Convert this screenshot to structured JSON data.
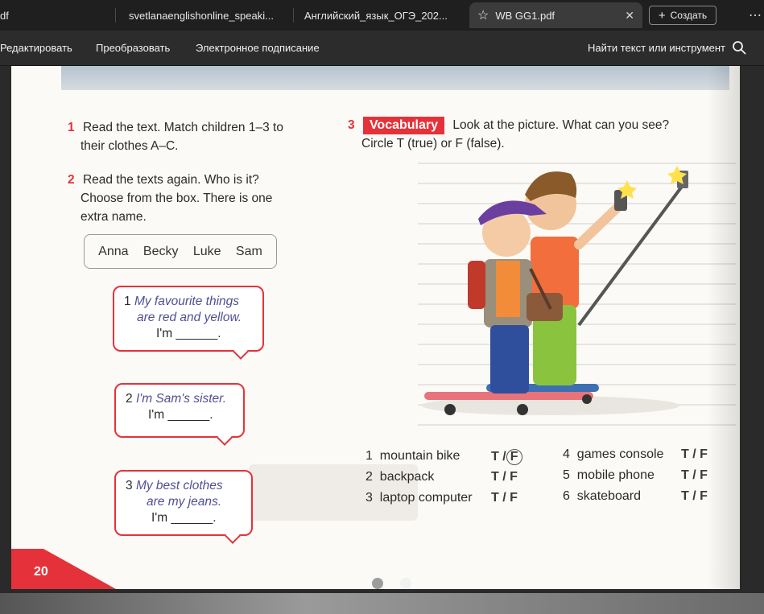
{
  "tabs": [
    {
      "label": "df"
    },
    {
      "label": "svetlanaenglishonline_speaki..."
    },
    {
      "label": "Английский_язык_ОГЭ_202..."
    },
    {
      "label": "WB GG1.pdf",
      "active": true
    }
  ],
  "create_label": "Создать",
  "menu": [
    "Редактировать",
    "Преобразовать",
    "Электронное подписание"
  ],
  "search_tool_label": "Найти текст или инструмент",
  "document": {
    "ex1": {
      "num": "1",
      "line1": "Read the text. Match children 1–3 to",
      "line2": "their clothes A–C."
    },
    "ex2": {
      "num": "2",
      "line1": "Read the texts again. Who is it?",
      "line2": "Choose from the box. There is one",
      "line3": "extra name."
    },
    "names": [
      "Anna",
      "Becky",
      "Luke",
      "Sam"
    ],
    "bubbles": [
      {
        "num": "1",
        "line1": "My favourite things",
        "line2": "are red and yellow.",
        "line3": "I'm ______."
      },
      {
        "num": "2",
        "line1": "I'm Sam's sister.",
        "line2": "I'm ______."
      },
      {
        "num": "3",
        "line1": "My best clothes",
        "line2": "are my jeans.",
        "line3": "I'm ______."
      }
    ],
    "ex3": {
      "num": "3",
      "badge": "Vocabulary",
      "line1": "Look at the picture. What can you see?",
      "line2": "Circle T (true) or F (false)."
    },
    "vocab_items": [
      {
        "n": "1",
        "word": "mountain bike",
        "tf": "T / F",
        "circled": "F"
      },
      {
        "n": "2",
        "word": "backpack",
        "tf": "T / F"
      },
      {
        "n": "3",
        "word": "laptop computer",
        "tf": "T / F"
      },
      {
        "n": "4",
        "word": "games console",
        "tf": "T / F"
      },
      {
        "n": "5",
        "word": "mobile phone",
        "tf": "T / F"
      },
      {
        "n": "6",
        "word": "skateboard",
        "tf": "T / F"
      }
    ],
    "page_number": "20"
  },
  "colors": {
    "accent_red": "#e5323a",
    "tab_bar": "#1f1f1f",
    "menu_bar": "#2c2c2c"
  },
  "icons": [
    "star-icon",
    "close-icon",
    "plus-icon",
    "search-icon",
    "more-icon"
  ]
}
